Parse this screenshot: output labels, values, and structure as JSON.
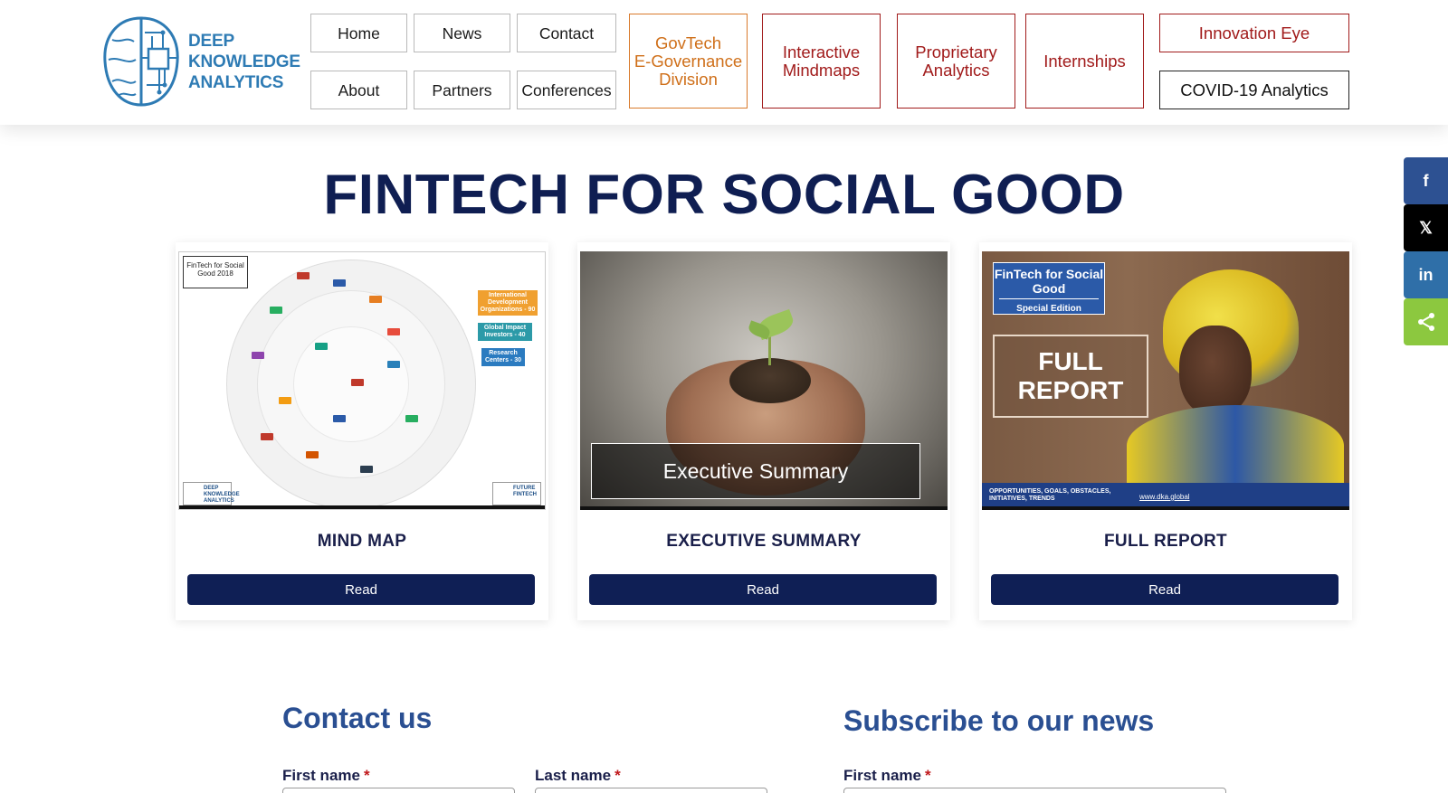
{
  "logo": {
    "line1": "DEEP",
    "line2": "KNOWLEDGE",
    "line3": "ANALYTICS"
  },
  "nav": {
    "home": "Home",
    "news": "News",
    "contact": "Contact",
    "about": "About",
    "partners": "Partners",
    "conferences": "Conferences",
    "govtech": "GovTech\nE-Governance\nDivision",
    "mindmaps": "Interactive\nMindmaps",
    "proprietary": "Proprietary\nAnalytics",
    "internships": "Internships",
    "innovation_eye": "Innovation Eye",
    "covid": "COVID-19 Analytics"
  },
  "page_title": "FINTECH FOR SOCIAL GOOD",
  "cards": [
    {
      "label": "MIND MAP",
      "button": "Read",
      "image": {
        "box_text": "FinTech for Social Good 2018",
        "tags": [
          "International Development Organizations - 90",
          "Global Impact Investors - 40",
          "Research Centers - 30"
        ],
        "corner_left": "DEEP KNOWLEDGE ANALYTICS",
        "corner_right": "FUTURE FINTECH"
      }
    },
    {
      "label": "EXECUTIVE SUMMARY",
      "button": "Read",
      "image": {
        "overlay": "Executive Summary"
      }
    },
    {
      "label": "FULL REPORT",
      "button": "Read",
      "image": {
        "badge_title": "FinTech for Social Good",
        "badge_sub": "Special Edition",
        "full_report": "FULL REPORT",
        "bottom_text": "OPPORTUNITIES, GOALS, OBSTACLES, INITIATIVES, TRENDS",
        "url": "www.dka.global"
      }
    }
  ],
  "contact": {
    "title": "Contact us",
    "first_name": "First name",
    "last_name": "Last name",
    "required": "*"
  },
  "subscribe": {
    "title": "Subscribe to our news",
    "first_name": "First name",
    "required": "*"
  },
  "share": [
    {
      "name": "facebook",
      "glyph": "f",
      "color": "#2d5192"
    },
    {
      "name": "x",
      "glyph": "𝕏",
      "color": "#000000"
    },
    {
      "name": "linkedin",
      "glyph": "in",
      "color": "#2f6fa8"
    },
    {
      "name": "share",
      "glyph": "⋖",
      "color": "#8cc83f"
    }
  ],
  "colors": {
    "navy": "#0f1f55",
    "title": "#0f1e52",
    "accent_blue": "#2a4f92",
    "red": "#a11b1b",
    "orange": "#cf6f19"
  }
}
